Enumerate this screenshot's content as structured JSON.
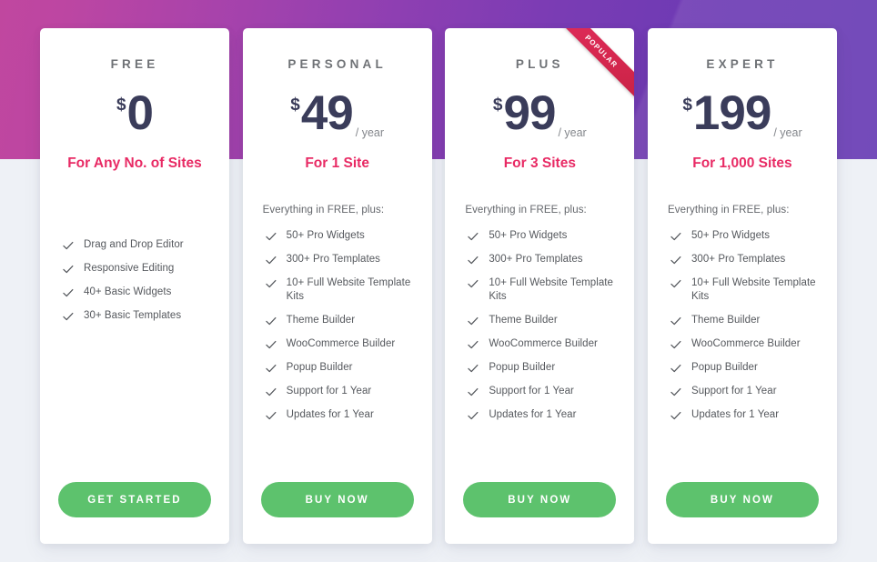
{
  "theme": {
    "gradient_left": "#c0479f",
    "gradient_right": "#663ab3",
    "page_background": "#eef1f6",
    "card_background": "#ffffff",
    "price_color": "#3a3c5a",
    "accent_pink": "#e82a64",
    "cta_green": "#5dc26d",
    "ribbon_red": "#d6274f",
    "plan_name_color": "#6f7276",
    "feature_text_color": "#55585d"
  },
  "plans": [
    {
      "name": "FREE",
      "currency": "$",
      "amount": "0",
      "period": "",
      "sites": "For Any No. of Sites",
      "plus_note": "",
      "features": [
        "Drag and Drop Editor",
        "Responsive Editing",
        "40+ Basic Widgets",
        "30+ Basic Templates"
      ],
      "cta_label": "GET STARTED",
      "popular": false,
      "badge_label": ""
    },
    {
      "name": "PERSONAL",
      "currency": "$",
      "amount": "49",
      "period": "/ year",
      "sites": "For 1 Site",
      "plus_note": "Everything in FREE, plus:",
      "features": [
        "50+ Pro Widgets",
        "300+ Pro Templates",
        "10+ Full Website Template Kits",
        "Theme Builder",
        "WooCommerce Builder",
        "Popup Builder",
        "Support for 1 Year",
        "Updates for 1 Year"
      ],
      "cta_label": "BUY NOW",
      "popular": false,
      "badge_label": ""
    },
    {
      "name": "PLUS",
      "currency": "$",
      "amount": "99",
      "period": "/ year",
      "sites": "For 3 Sites",
      "plus_note": "Everything in FREE, plus:",
      "features": [
        "50+ Pro Widgets",
        "300+ Pro Templates",
        "10+ Full Website Template Kits",
        "Theme Builder",
        "WooCommerce Builder",
        "Popup Builder",
        "Support for 1 Year",
        "Updates for 1 Year"
      ],
      "cta_label": "BUY NOW",
      "popular": true,
      "badge_label": "POPULAR"
    },
    {
      "name": "EXPERT",
      "currency": "$",
      "amount": "199",
      "period": "/ year",
      "sites": "For 1,000 Sites",
      "plus_note": "Everything in FREE, plus:",
      "features": [
        "50+ Pro Widgets",
        "300+ Pro Templates",
        "10+ Full Website Template Kits",
        "Theme Builder",
        "WooCommerce Builder",
        "Popup Builder",
        "Support for 1 Year",
        "Updates for 1 Year"
      ],
      "cta_label": "BUY NOW",
      "popular": false,
      "badge_label": ""
    }
  ]
}
